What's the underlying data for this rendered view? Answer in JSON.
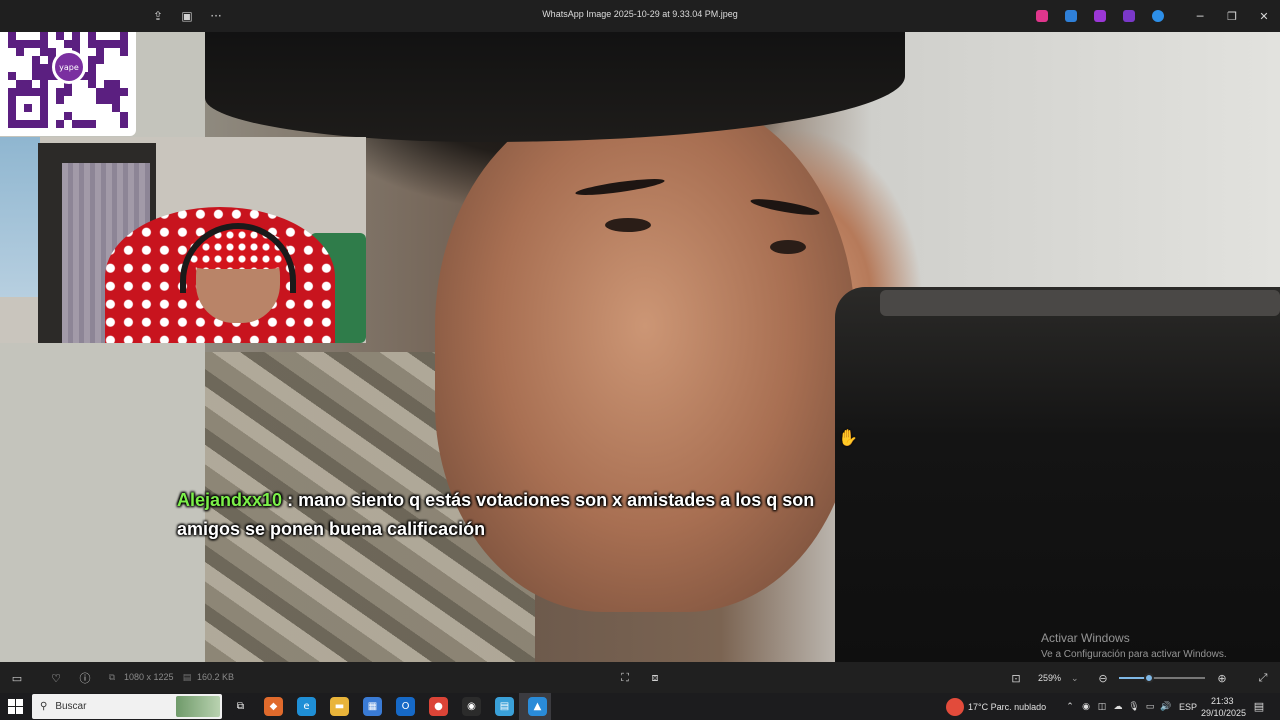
{
  "window": {
    "title": "WhatsApp Image 2025-10-29 at 9.33.04 PM.jpeg",
    "toolbar": [
      {
        "icon": "share-icon",
        "glyph": "⇪"
      },
      {
        "icon": "slideshow-icon",
        "glyph": "▣"
      },
      {
        "icon": "more-icon",
        "glyph": "···"
      }
    ],
    "app_icons": [
      {
        "icon": "copilot-icon",
        "color": "#e0368c"
      },
      {
        "icon": "designer-icon",
        "color": "#2f80d8"
      },
      {
        "icon": "clipchamp-icon",
        "color": "#9b37d6"
      },
      {
        "icon": "onenote-icon",
        "color": "#7a38c8"
      },
      {
        "icon": "onedrive-icon",
        "color": "#2d8fe8"
      }
    ],
    "controls": {
      "minimize": "─",
      "restore": "❐",
      "close": "✕"
    }
  },
  "overlay": {
    "qr_logo_text": "yape",
    "chat": {
      "user": "Alejandxx10",
      "separator": " : ",
      "message": "mano siento q estás votaciones son x amistades a los q son amigos se ponen buena calificación"
    },
    "cursor": "✋"
  },
  "watermark": {
    "line1": "Activar Windows",
    "line2": "Ve a Configuración para activar Windows."
  },
  "statusbar": {
    "dimensions": "1080 x 1225",
    "file_size": "160.2 KB",
    "zoom": "259%",
    "zoom_slider_fraction": 0.35
  },
  "taskbar": {
    "search_placeholder": "Buscar",
    "apps": [
      {
        "icon": "task-view-icon",
        "color": "#1c1c1e",
        "glyph": "⧉"
      },
      {
        "icon": "copilot-icon",
        "color": "#e06a2c",
        "glyph": "◆"
      },
      {
        "icon": "edge-icon",
        "color": "#1f8fd6",
        "glyph": "e"
      },
      {
        "icon": "file-explorer-icon",
        "color": "#e9b43a",
        "glyph": "▬"
      },
      {
        "icon": "store-icon",
        "color": "#3a7bd5",
        "glyph": "▦"
      },
      {
        "icon": "outlook-icon",
        "color": "#1669c7",
        "glyph": "O"
      },
      {
        "icon": "chrome-icon",
        "color": "#db4437",
        "glyph": "●"
      },
      {
        "icon": "obs-icon",
        "color": "#2b2b2b",
        "glyph": "◉"
      },
      {
        "icon": "notepad-icon",
        "color": "#3aa0d8",
        "glyph": "▤"
      },
      {
        "icon": "photos-icon",
        "color": "#2a8bd8",
        "glyph": "▲"
      }
    ],
    "weather": "17°C  Parc. nublado",
    "language": "ESP",
    "time": "21:33",
    "date": "29/10/2025"
  }
}
